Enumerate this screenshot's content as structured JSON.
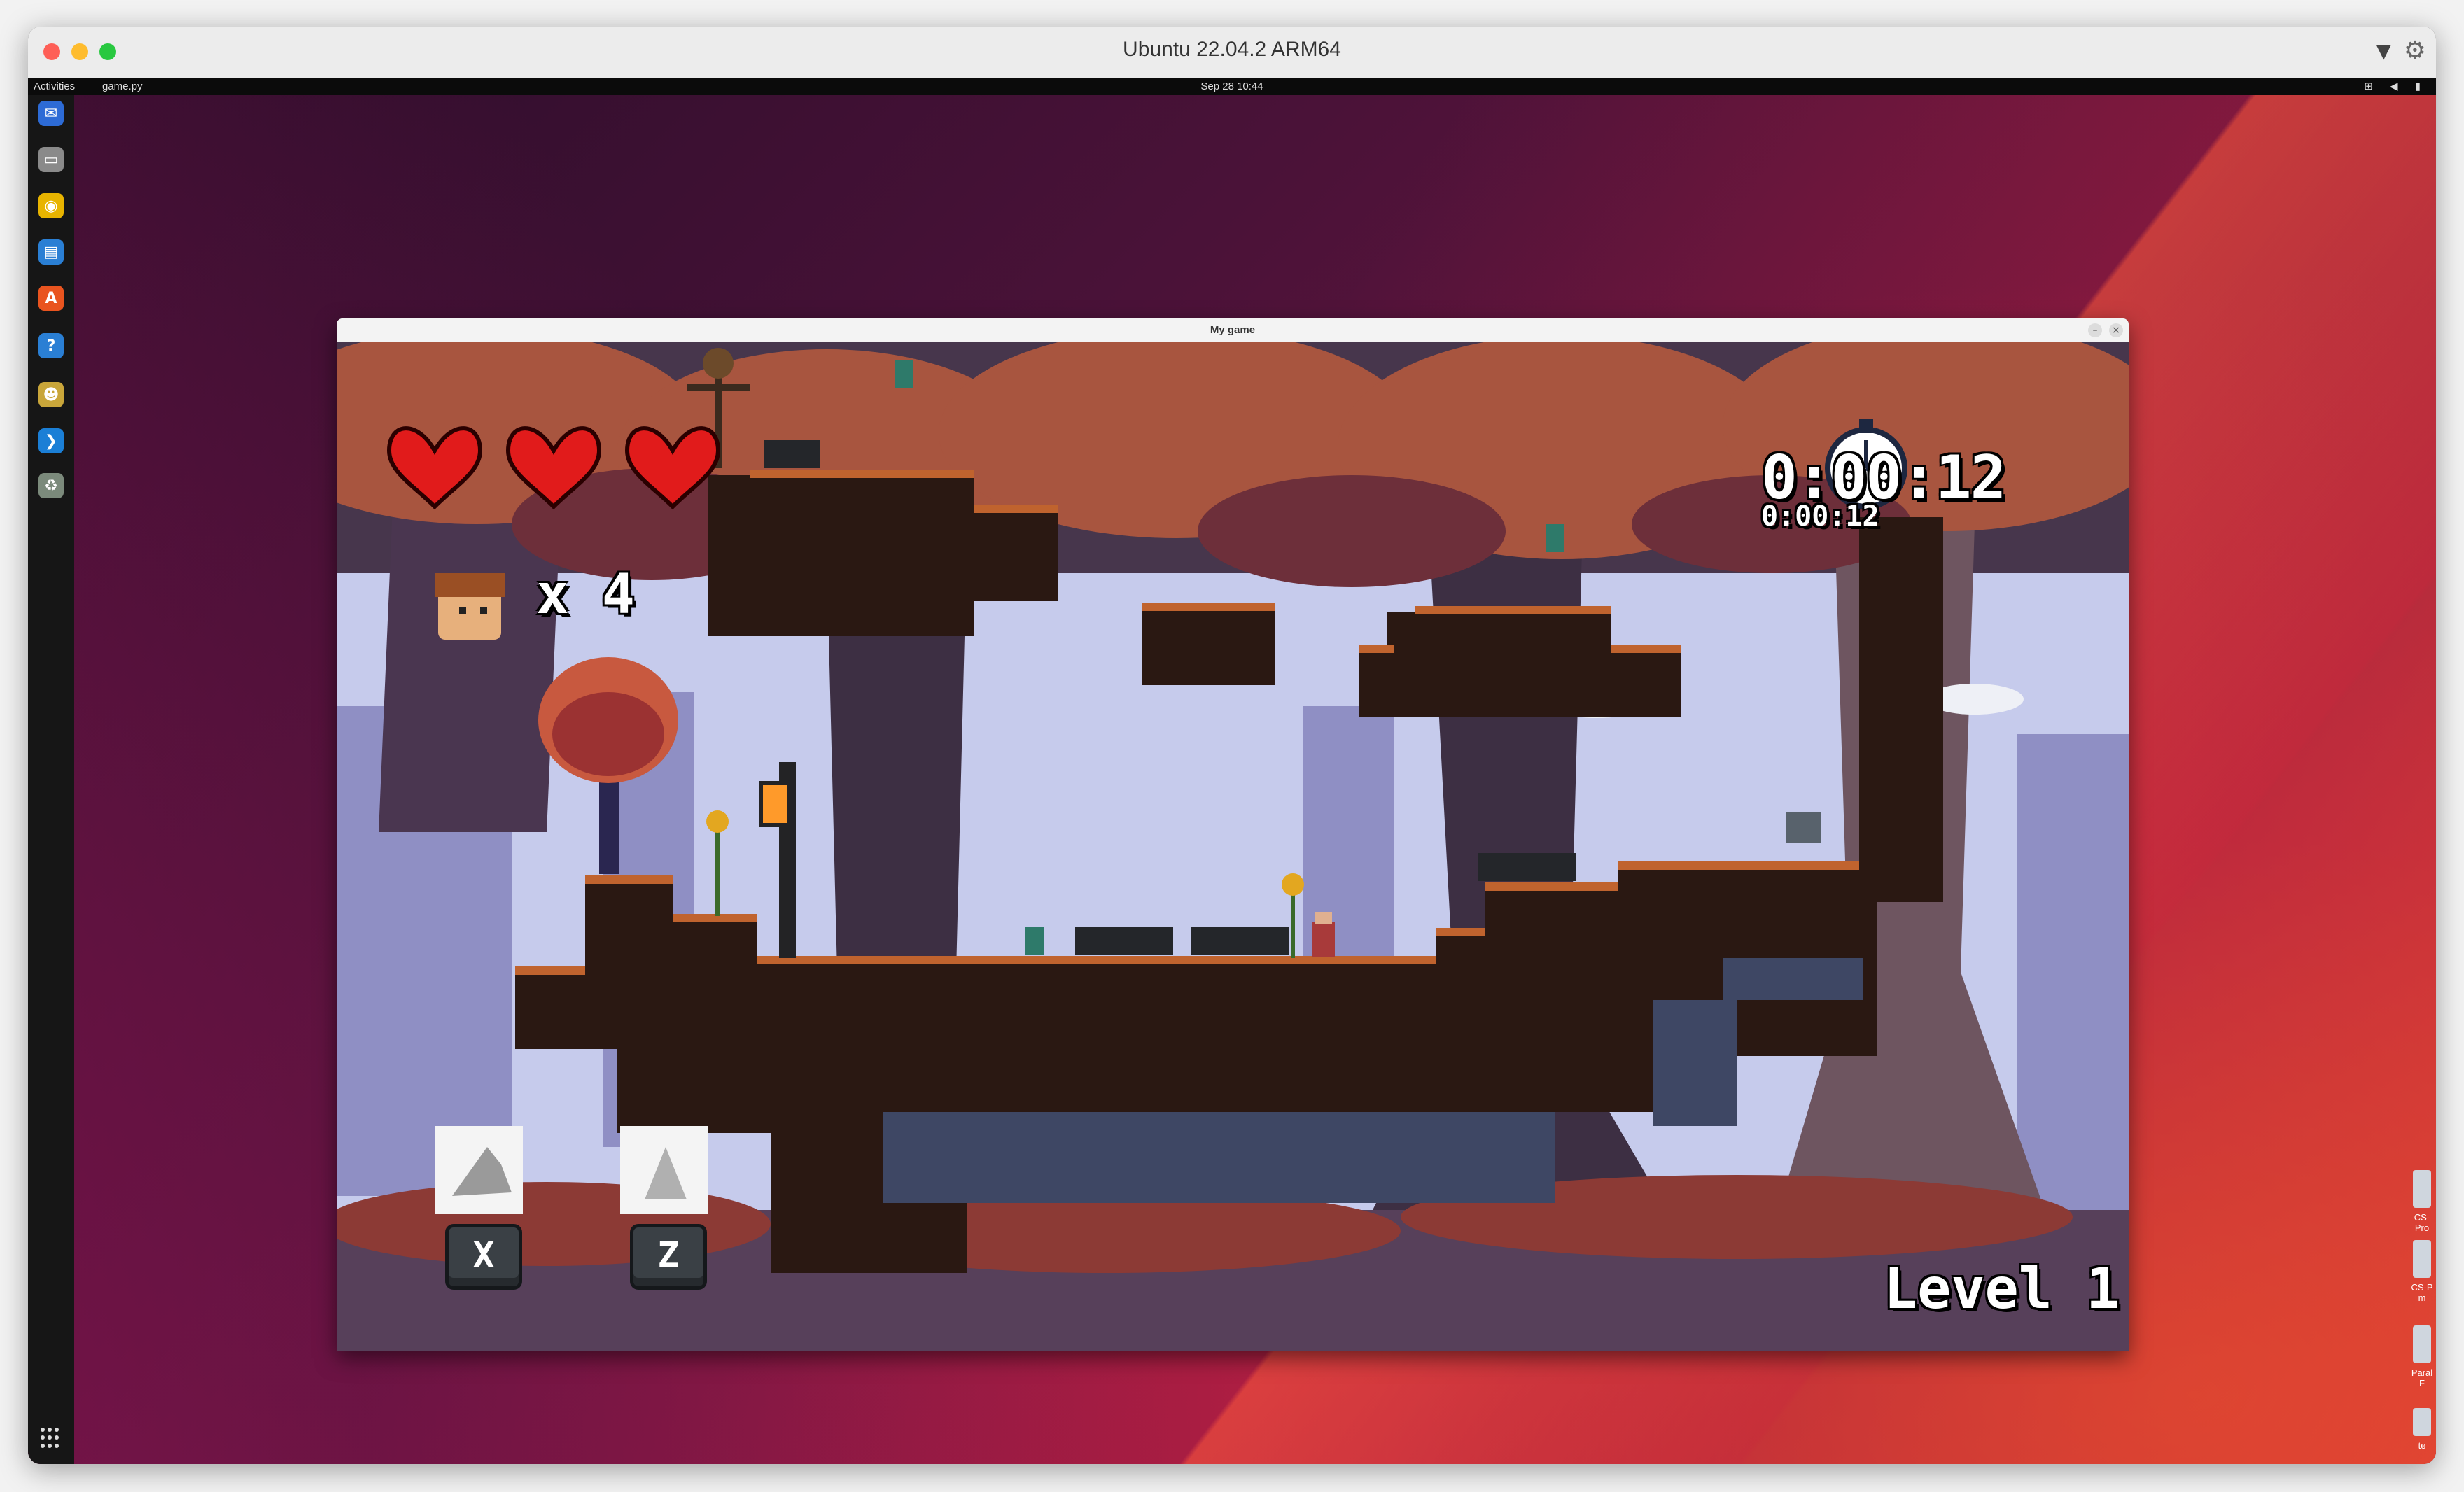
{
  "vm": {
    "title": "Ubuntu 22.04.2 ARM64",
    "dropdown_icon": "▼",
    "settings_icon": "⚙"
  },
  "top_bar": {
    "activities": "Activities",
    "app_menu": "game.py",
    "clock": "Sep 28  10:44",
    "tray": "⊞ ◀ ▮"
  },
  "dock": {
    "items": [
      {
        "name": "thunderbird",
        "glyph": "✉",
        "color": "#2d6bd6"
      },
      {
        "name": "files",
        "glyph": "▭",
        "color": "#8a8a8a"
      },
      {
        "name": "rhythmbox",
        "glyph": "◉",
        "color": "#e8b400"
      },
      {
        "name": "writer",
        "glyph": "▤",
        "color": "#2a7fd4"
      },
      {
        "name": "app-center",
        "glyph": "A",
        "color": "#e9541f"
      },
      {
        "name": "help",
        "glyph": "?",
        "color": "#2a7fd4"
      },
      {
        "name": "python-game",
        "glyph": "☻",
        "color": "#c9a63a"
      },
      {
        "name": "vscode",
        "glyph": "❯",
        "color": "#1b7fd6"
      },
      {
        "name": "trash",
        "glyph": "♻",
        "color": "#7b8a7b"
      }
    ]
  },
  "desktop_files": [
    {
      "label": "CS-Pro"
    },
    {
      "label": "CS-P\nm"
    },
    {
      "label": "Paral\nF"
    },
    {
      "label": "te"
    }
  ],
  "game": {
    "window_title": "My game",
    "min_button": "–",
    "close_button": "×",
    "lives": "x 4",
    "timer": "0:00:12",
    "timer_sub": "0:00:12",
    "level": "Level 1",
    "key_dash": "X",
    "key_jump": "Z"
  },
  "colors": {
    "sky": "#c6cbec",
    "tree_dark": "#3d2f43",
    "leaves": "#b55a3e",
    "ground_dark": "#2a1812",
    "ground_top": "#c0632e",
    "stone": "#3e4764",
    "heart": "#e11b1b"
  }
}
